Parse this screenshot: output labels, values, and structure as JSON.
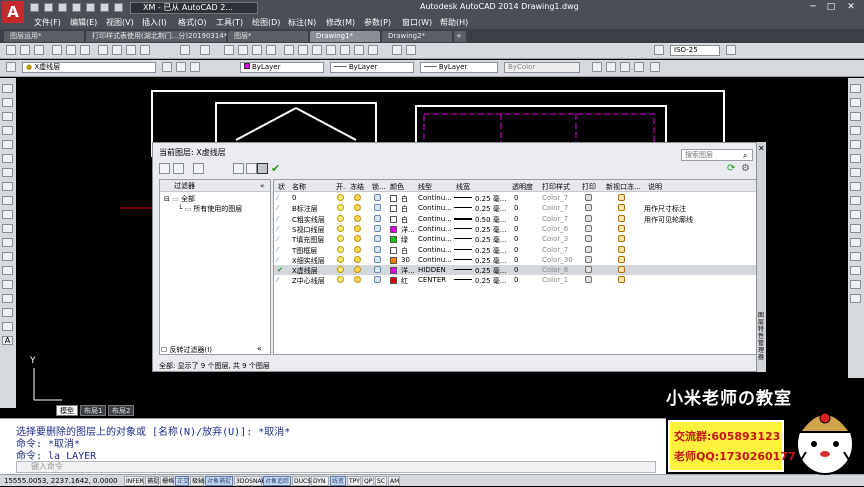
{
  "titlebar": {
    "app_letter": "A",
    "workspace": "XM - 已从 AutoCAD 2...",
    "title": "Autodesk AutoCAD 2014     Drawing1.dwg"
  },
  "menus": [
    "文件(F)",
    "编辑(E)",
    "视图(V)",
    "插入(I)",
    "格式(O)",
    "工具(T)",
    "绘图(D)",
    "标注(N)",
    "修改(M)",
    "参数(P)",
    "窗口(W)",
    "帮助(H)"
  ],
  "doc_tabs": [
    {
      "label": "图层运用*",
      "active": false
    },
    {
      "label": "打印样式表使用(湖北荆门...分)20190314*",
      "active": false
    },
    {
      "label": "图层*",
      "active": false
    },
    {
      "label": "Drawing1*",
      "active": true
    },
    {
      "label": "Drawing2*",
      "active": false
    }
  ],
  "toolbar_std": {
    "dimstyle": "ISO-25"
  },
  "toolbar_props": {
    "current_layer": "X虚线层",
    "color": "ByLayer",
    "linetype": "ByLayer",
    "lineweight": "ByLayer",
    "plotstyle": "ByColor"
  },
  "layer_manager": {
    "current_layer_label": "当前图层: X虚线层",
    "search_placeholder": "搜索图层",
    "filters_header": "过滤器",
    "tree": [
      "全部",
      "所有使用的图层"
    ],
    "invert_filter": "反转过滤器(I)",
    "columns": [
      "状",
      "名称",
      "开.",
      "冻结",
      "锁...",
      "颜色",
      "线型",
      "线宽",
      "透明度",
      "打印样式",
      "打印",
      "新视口冻...",
      "说明"
    ],
    "rows": [
      {
        "name": "0",
        "color_name": "白",
        "color": "#ffffff",
        "linetype": "Continu...",
        "lineweight": "0.25 毫...",
        "transparency": "0",
        "plotstyle": "Color_7",
        "desc": "",
        "current": false
      },
      {
        "name": "B标注层",
        "color_name": "白",
        "color": "#ffffff",
        "linetype": "Continu...",
        "lineweight": "0.25 毫...",
        "transparency": "0",
        "plotstyle": "Color_7",
        "desc": "用作尺寸标注",
        "current": false
      },
      {
        "name": "C粗实线层",
        "color_name": "白",
        "color": "#ffffff",
        "linetype": "Continu...",
        "lineweight": "0.50 毫...",
        "transparency": "0",
        "plotstyle": "Color_7",
        "desc": "用作可见轮廓线",
        "current": false
      },
      {
        "name": "S视口线层",
        "color_name": "洋...",
        "color": "#e400e4",
        "linetype": "Continu...",
        "lineweight": "0.25 毫...",
        "transparency": "0",
        "plotstyle": "Color_6",
        "desc": "",
        "current": false
      },
      {
        "name": "T填充图层",
        "color_name": "绿",
        "color": "#18c418",
        "linetype": "Continu...",
        "lineweight": "0.25 毫...",
        "transparency": "0",
        "plotstyle": "Color_3",
        "desc": "",
        "current": false
      },
      {
        "name": "T图框层",
        "color_name": "白",
        "color": "#ffffff",
        "linetype": "Continu...",
        "lineweight": "0.25 毫...",
        "transparency": "0",
        "plotstyle": "Color_7",
        "desc": "",
        "current": false
      },
      {
        "name": "X细实线层",
        "color_name": "30",
        "color": "#ff7f00",
        "linetype": "Continu...",
        "lineweight": "0.25 毫...",
        "transparency": "0",
        "plotstyle": "Color_30",
        "desc": "",
        "current": false
      },
      {
        "name": "X虚线层",
        "color_name": "洋...",
        "color": "#e400e4",
        "linetype": "HIDDEN",
        "lineweight": "0.25 毫...",
        "transparency": "0",
        "plotstyle": "Color_6",
        "desc": "",
        "current": true
      },
      {
        "name": "Z中心线层",
        "color_name": "红",
        "color": "#e00000",
        "linetype": "CENTER",
        "lineweight": "0.25 毫...",
        "transparency": "0",
        "plotstyle": "Color_1",
        "desc": "",
        "current": false
      }
    ],
    "status": "全部: 显示了 9 个图层, 共 9 个图层",
    "side_title": "图层特性管理器"
  },
  "layout_tabs": [
    {
      "label": "模型",
      "active": true
    },
    {
      "label": "布局1",
      "active": false
    },
    {
      "label": "布局2",
      "active": false
    }
  ],
  "command": {
    "lines": [
      "选择要删除的图层上的对象或 [名称(N)/放弃(U)]: *取消*",
      "命令: *取消*",
      "命令: la LAYER"
    ],
    "placeholder": "键入命令"
  },
  "ucs": {
    "y_label": "Y"
  },
  "statusbar": {
    "coords": "15555.0053, 2237.1642, 0.0000",
    "buttons": [
      {
        "label": "INFER",
        "on": false
      },
      {
        "label": "捕捉",
        "on": false
      },
      {
        "label": "栅格",
        "on": false
      },
      {
        "label": "正交",
        "on": true
      },
      {
        "label": "极轴",
        "on": false
      },
      {
        "label": "对象捕捉",
        "on": true
      },
      {
        "label": "3DOSNAP",
        "on": false
      },
      {
        "label": "对象追踪",
        "on": true
      },
      {
        "label": "DUCS",
        "on": false
      },
      {
        "label": "DYN",
        "on": false
      },
      {
        "label": "线宽",
        "on": true
      },
      {
        "label": "TPY",
        "on": false
      },
      {
        "label": "QP",
        "on": false
      },
      {
        "label": "SC",
        "on": false
      },
      {
        "label": "AM",
        "on": false
      }
    ]
  },
  "watermark": {
    "banner": "小米老师の教室",
    "group": "交流群:605893123",
    "qq": "老师QQ:1730260177"
  }
}
